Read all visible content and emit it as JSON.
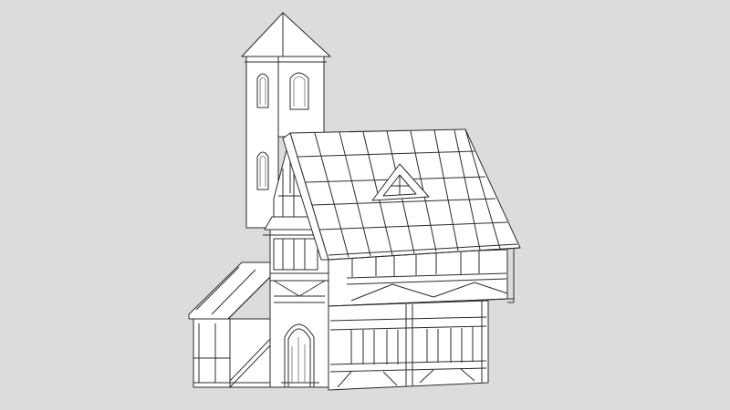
{
  "viewport": {
    "background": "#dcdcdc",
    "line_color": "#2b2b2b",
    "fill_color": "#ffffff"
  },
  "model": {
    "parts": [
      "bell-tower",
      "main-roof",
      "dormer-window",
      "upper-floor",
      "ground-floor",
      "arched-door",
      "side-shed"
    ]
  }
}
